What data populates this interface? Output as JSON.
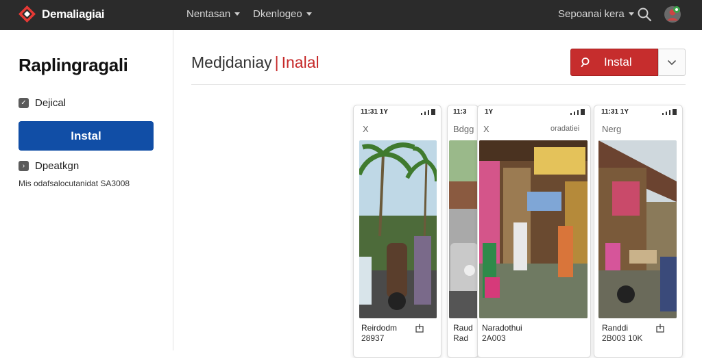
{
  "topbar": {
    "brand": "Demaliagiai",
    "nav": [
      {
        "label": "Nentasan"
      },
      {
        "label": "Dkenlogeo"
      }
    ],
    "user_menu": "Sepoanai kera",
    "search_icon": "search-icon",
    "avatar_icon": "avatar"
  },
  "sidebar": {
    "title": "Raplingragali",
    "row1_label": "Dejical",
    "install_label": "Instal",
    "row2_label": "Dpeatkgn",
    "meta": "Mis odafsalocutanidat SA3008"
  },
  "main": {
    "heading": "Medjdaniay",
    "heading_sep": "|",
    "heading_accent": "Inalal",
    "install_label": "Instal",
    "dropdown_icon": "chevron-down-icon"
  },
  "cards": [
    {
      "time": "11:31 1Y",
      "head": "X",
      "head_right": "",
      "caption": "Reirdodm",
      "sub": "28937"
    },
    {
      "time": "11:3",
      "head": "Bdgg",
      "head_right": "",
      "caption": "Raud",
      "sub": "Rad"
    },
    {
      "time": "1Y",
      "head": "X",
      "head_right": "oradatiei",
      "caption": "Naradothui",
      "sub": "2A003"
    },
    {
      "time": "11:31 1Y",
      "head": "Nerg",
      "head_right": "",
      "caption": "Randdi",
      "sub": "2B003 10K"
    }
  ],
  "colors": {
    "topbar_bg": "#2b2b2b",
    "primary_blue": "#114ea6",
    "accent_red": "#c62d2d"
  }
}
